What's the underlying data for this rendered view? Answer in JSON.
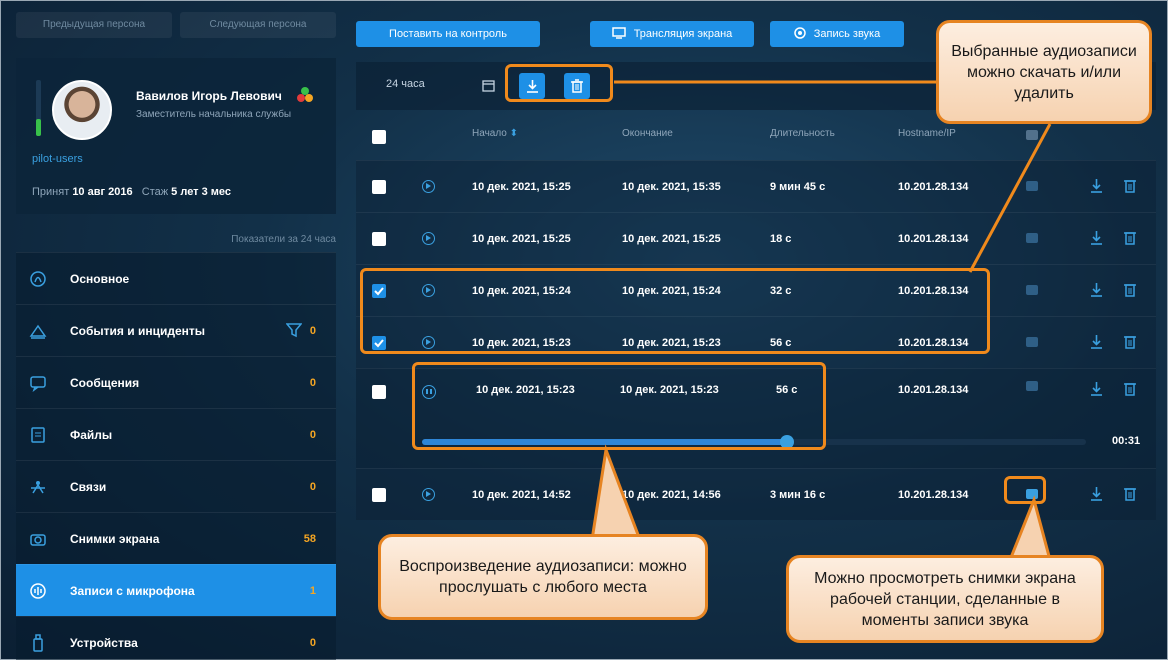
{
  "sidebar": {
    "prev_persona": "Предыдущая персона",
    "next_persona": "Следующая персона",
    "profile": {
      "name": "Вавилов Игорь Левович",
      "position": "Заместитель начальника службы",
      "login": "pilot-users",
      "hired_label": "Принят",
      "hired_date": "10 авг 2016",
      "tenure_label": "Стаж",
      "tenure_value": "5 лет 3 мес",
      "activity_level": 0.3
    },
    "metrics_period": "Показатели за 24 часа",
    "menu": [
      {
        "label": "Основное",
        "icon": "fingerprint-icon",
        "count": ""
      },
      {
        "label": "События и инциденты",
        "icon": "incidents-icon",
        "count": "0"
      },
      {
        "label": "Сообщения",
        "icon": "message-icon",
        "count": "0"
      },
      {
        "label": "Файлы",
        "icon": "file-icon",
        "count": "0"
      },
      {
        "label": "Связи",
        "icon": "connections-icon",
        "count": "0"
      },
      {
        "label": "Снимки экрана",
        "icon": "camera-icon",
        "count": "58"
      },
      {
        "label": "Записи с микрофона",
        "icon": "microphone-icon",
        "count": "1"
      },
      {
        "label": "Устройства",
        "icon": "usb-device-icon",
        "count": "0"
      }
    ]
  },
  "toolbar": {
    "monitor_label": "Поставить на контроль",
    "screencast_label": "Трансляция экрана",
    "audio_record_label": "Запись звука"
  },
  "filter": {
    "period": "24 часа"
  },
  "table": {
    "headers": {
      "start": "Начало",
      "end": "Окончание",
      "duration": "Длительность",
      "host": "Hostname/IP"
    },
    "rows": [
      {
        "start": "10 дек. 2021, 15:25",
        "end": "10 дек. 2021, 15:35",
        "duration": "9 мин 45 с",
        "host": "10.201.28.134",
        "checked": false
      },
      {
        "start": "10 дек. 2021, 15:25",
        "end": "10 дек. 2021, 15:25",
        "duration": "18 с",
        "host": "10.201.28.134",
        "checked": false
      },
      {
        "start": "10 дек. 2021, 15:24",
        "end": "10 дек. 2021, 15:24",
        "duration": "32 с",
        "host": "10.201.28.134",
        "checked": true
      },
      {
        "start": "10 дек. 2021, 15:23",
        "end": "10 дек. 2021, 15:23",
        "duration": "56 с",
        "host": "10.201.28.134",
        "checked": true
      },
      {
        "start": "10 дек. 2021, 15:23",
        "end": "10 дек. 2021, 15:23",
        "duration": "56 с",
        "host": "10.201.28.134",
        "checked": false,
        "playing": true,
        "progress": 0.55,
        "elapsed": "00:31"
      },
      {
        "start": "10 дек. 2021, 14:52",
        "end": "10 дек. 2021, 14:56",
        "duration": "3 мин 16 с",
        "host": "10.201.28.134",
        "checked": false
      }
    ]
  },
  "callouts": {
    "selected": "Выбранные аудиозаписи можно скачать и/или удалить",
    "playback": "Воспроизведение аудиозаписи: можно прослушать с любого места",
    "screenshots": "Можно просмотреть снимки экрана рабочей станции, сделанные в моменты записи звука"
  },
  "colors": {
    "accent": "#1e90e6",
    "counter": "#f5a623",
    "callout_border": "#e68422",
    "status_green": "#38c14a"
  }
}
